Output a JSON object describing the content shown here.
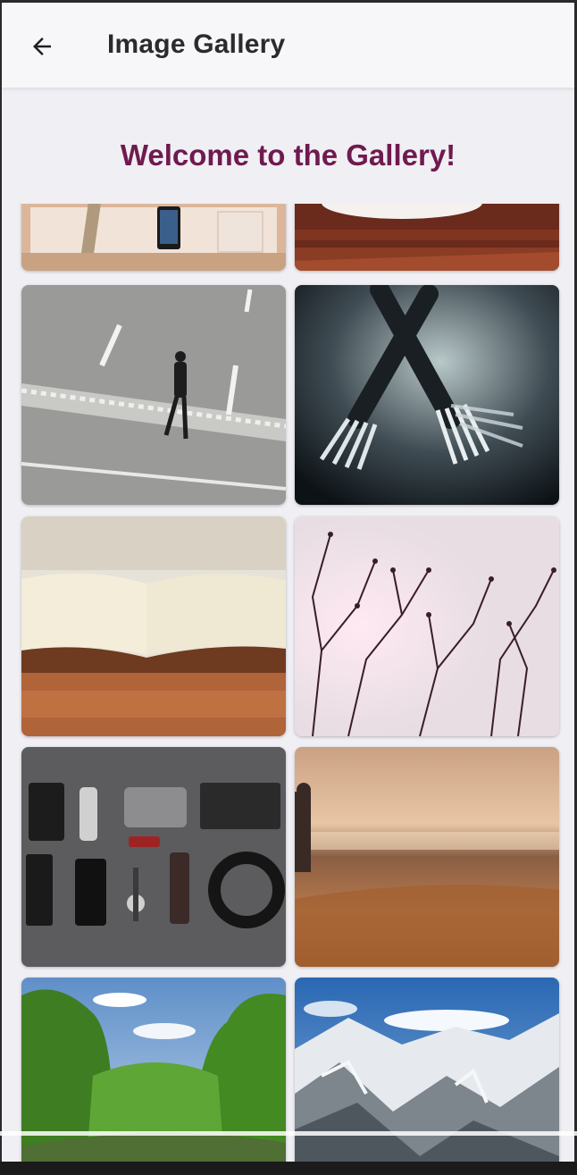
{
  "appbar": {
    "title": "Image Gallery",
    "back_icon": "arrow-left-icon"
  },
  "welcome_text": "Welcome to the Gallery!",
  "colors": {
    "accent": "#6f1a4f",
    "background": "#f0eff4",
    "appbar": "#f7f6f9"
  },
  "gallery": {
    "columns": 2,
    "images": [
      "desk-with-phone",
      "rusty-floor",
      "person-walking-street",
      "crossed-forks",
      "open-book",
      "tree-branches-sunset",
      "flat-lay-gadgets",
      "beach-sunset",
      "green-forest-valley",
      "snowy-mountains"
    ]
  }
}
